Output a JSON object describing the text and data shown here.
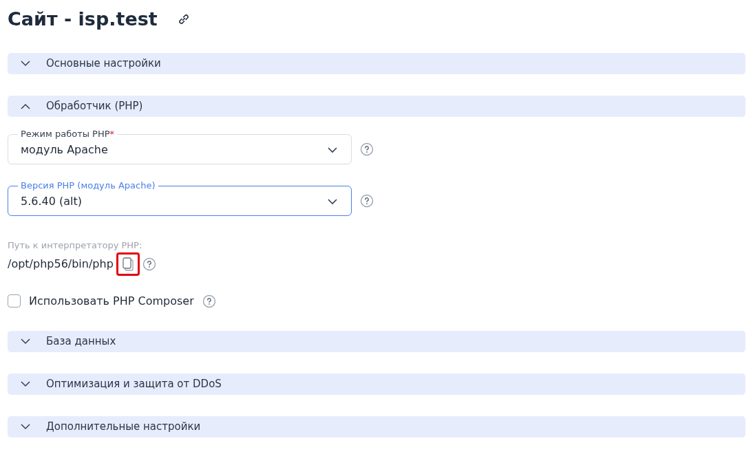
{
  "title": "Сайт - isp.test",
  "sections": [
    {
      "label": "Основные настройки",
      "expanded": false
    },
    {
      "label": "Обработчик (PHP)",
      "expanded": true,
      "fields": [
        {
          "kind": "select",
          "label": "Режим работы PHP",
          "required_mark": "*",
          "focused": false,
          "value": "модуль Apache"
        },
        {
          "kind": "select",
          "label": "Версия PHP (модуль Apache)",
          "focused": true,
          "value": "5.6.40 (alt)"
        },
        {
          "kind": "path",
          "label": "Путь к интерпретатору PHP:",
          "value": "/opt/php56/bin/php",
          "highlighted": true
        },
        {
          "kind": "checkbox",
          "label": "Использовать PHP Composer",
          "checked": false
        }
      ]
    },
    {
      "label": "База данных",
      "expanded": false
    },
    {
      "label": "Оптимизация и защита от DDoS",
      "expanded": false
    },
    {
      "label": "Дополнительные настройки",
      "expanded": false
    }
  ]
}
